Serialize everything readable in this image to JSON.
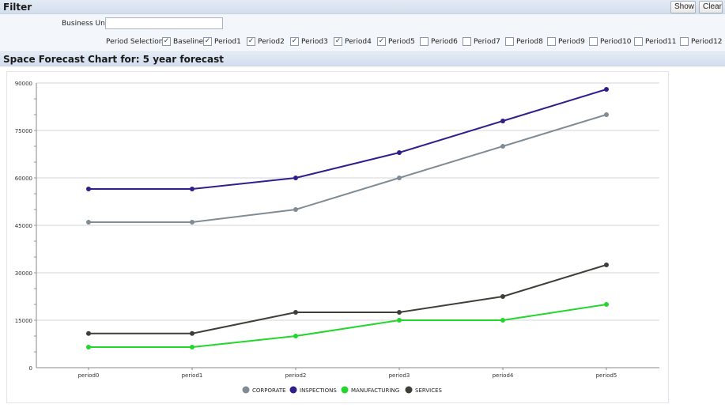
{
  "filter": {
    "title": "Filter",
    "show_label": "Show",
    "clear_label": "Clear",
    "business_unit_label": "Business Unit",
    "business_unit_value": "",
    "period_selection_label": "Period Selection:",
    "periods": [
      {
        "label": "Baseline",
        "checked": true
      },
      {
        "label": "Period1",
        "checked": true
      },
      {
        "label": "Period2",
        "checked": true
      },
      {
        "label": "Period3",
        "checked": true
      },
      {
        "label": "Period4",
        "checked": true
      },
      {
        "label": "Period5",
        "checked": true
      },
      {
        "label": "Period6",
        "checked": false
      },
      {
        "label": "Period7",
        "checked": false
      },
      {
        "label": "Period8",
        "checked": false
      },
      {
        "label": "Period9",
        "checked": false
      },
      {
        "label": "Period10",
        "checked": false
      },
      {
        "label": "Period11",
        "checked": false
      },
      {
        "label": "Period12",
        "checked": false
      }
    ]
  },
  "chart_header": {
    "title": "Space Forecast Chart for: 5 year forecast"
  },
  "chart_data": {
    "type": "line",
    "categories": [
      "period0",
      "period1",
      "period2",
      "period3",
      "period4",
      "period5"
    ],
    "ylim": [
      0,
      90000
    ],
    "y_ticks": [
      "0",
      "15000",
      "30000",
      "45000",
      "60000",
      "75000",
      "90000"
    ],
    "grid": true,
    "legend_position": "bottom",
    "series": [
      {
        "name": "CORPORATE",
        "color": "#7f8c96",
        "values": [
          46000,
          46000,
          50000,
          60000,
          70000,
          80000
        ]
      },
      {
        "name": "INSPECTIONS",
        "color": "#2e1f8a",
        "values": [
          56500,
          56500,
          60000,
          68000,
          78000,
          88000
        ]
      },
      {
        "name": "MANUFACTURING",
        "color": "#22d62c",
        "values": [
          6500,
          6500,
          10000,
          15000,
          15000,
          20000
        ]
      },
      {
        "name": "SERVICES",
        "color": "#3f3f38",
        "values": [
          10800,
          10800,
          17500,
          17500,
          22500,
          32500
        ]
      }
    ]
  }
}
